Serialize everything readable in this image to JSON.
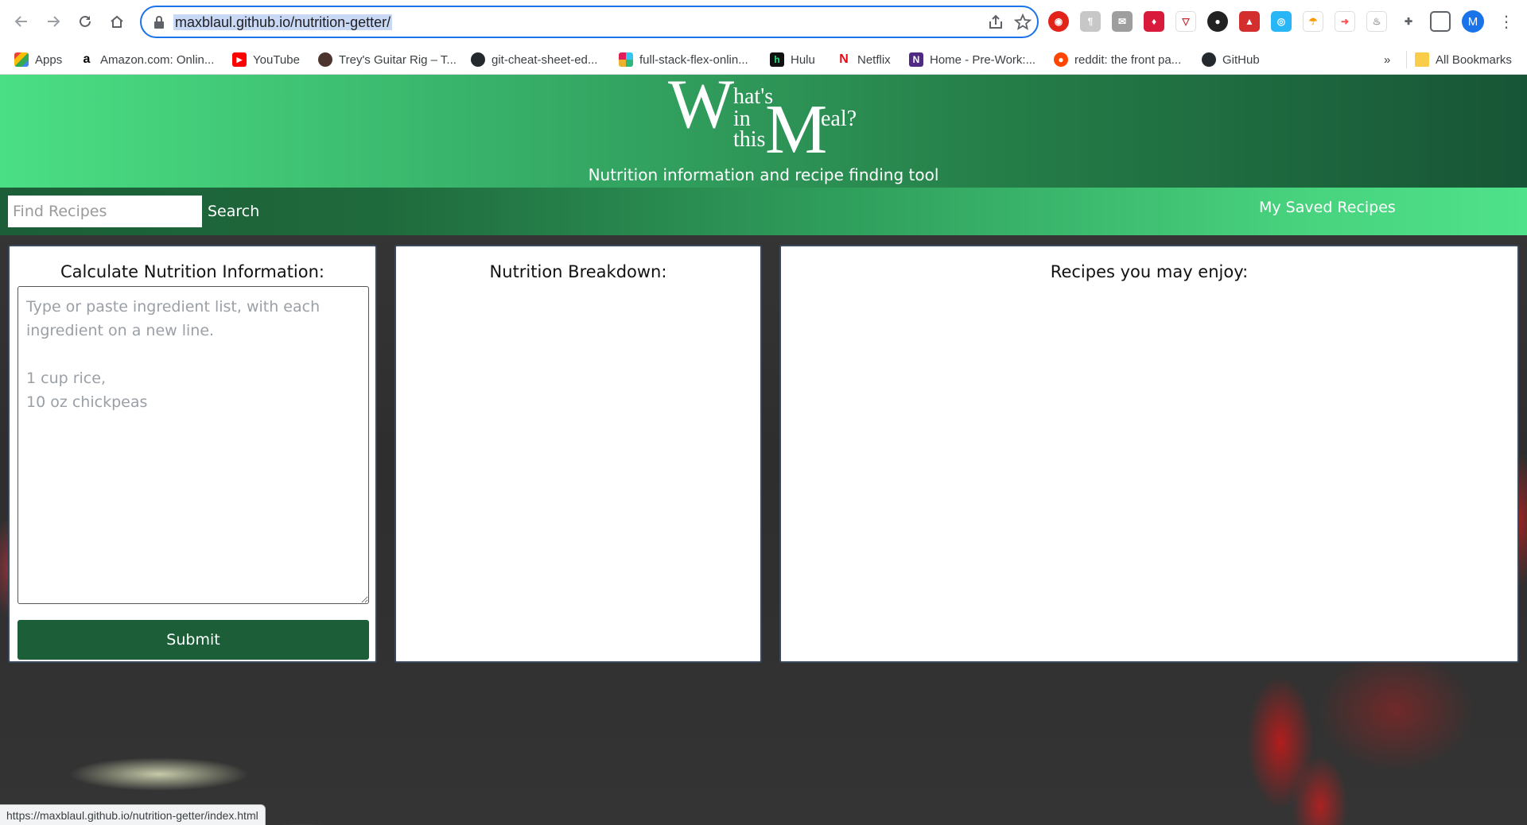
{
  "browser": {
    "url_domain": "maxblaul.github.io",
    "url_path": "/nutrition-getter/",
    "profile_initial": "M",
    "status_url": "https://maxblaul.github.io/nutrition-getter/index.html",
    "accent_color": "#1a73e8"
  },
  "bookmarks": {
    "items": [
      {
        "label": "Apps",
        "icon": "apps-grid-icon"
      },
      {
        "label": "Amazon.com: Onlin...",
        "icon": "amazon-icon"
      },
      {
        "label": "YouTube",
        "icon": "youtube-icon"
      },
      {
        "label": "Trey's Guitar Rig – T...",
        "icon": "guitar-site-icon"
      },
      {
        "label": "git-cheat-sheet-ed...",
        "icon": "github-icon"
      },
      {
        "label": "full-stack-flex-onlin...",
        "icon": "slack-icon"
      },
      {
        "label": "Hulu",
        "icon": "hulu-icon"
      },
      {
        "label": "Netflix",
        "icon": "netflix-icon"
      },
      {
        "label": "Home - Pre-Work:...",
        "icon": "notion-icon"
      },
      {
        "label": "reddit: the front pa...",
        "icon": "reddit-icon"
      },
      {
        "label": "GitHub",
        "icon": "github-icon"
      }
    ],
    "overflow": "»",
    "all_bookmarks": "All Bookmarks"
  },
  "site": {
    "logo": {
      "w": "W",
      "hat": "hat's",
      "in": "in",
      "this": "this",
      "m": "M",
      "eal": "eal?"
    },
    "tagline": "Nutrition information and recipe finding tool",
    "colors": {
      "hero_start": "#4bdf84",
      "hero_end": "#175536",
      "dark_green": "#1b5e37"
    }
  },
  "nav": {
    "search_placeholder": "Find Recipes",
    "search_button": "Search",
    "saved_recipes": "My Saved Recipes"
  },
  "panels": {
    "calculate": {
      "title": "Calculate Nutrition Information:",
      "placeholder": "Type or paste ingredient list, with each ingredient on a new line.\n\n1 cup rice,\n10 oz chickpeas",
      "submit": "Submit"
    },
    "breakdown": {
      "title": "Nutrition Breakdown:"
    },
    "recipes": {
      "title": "Recipes you may enjoy:"
    }
  }
}
